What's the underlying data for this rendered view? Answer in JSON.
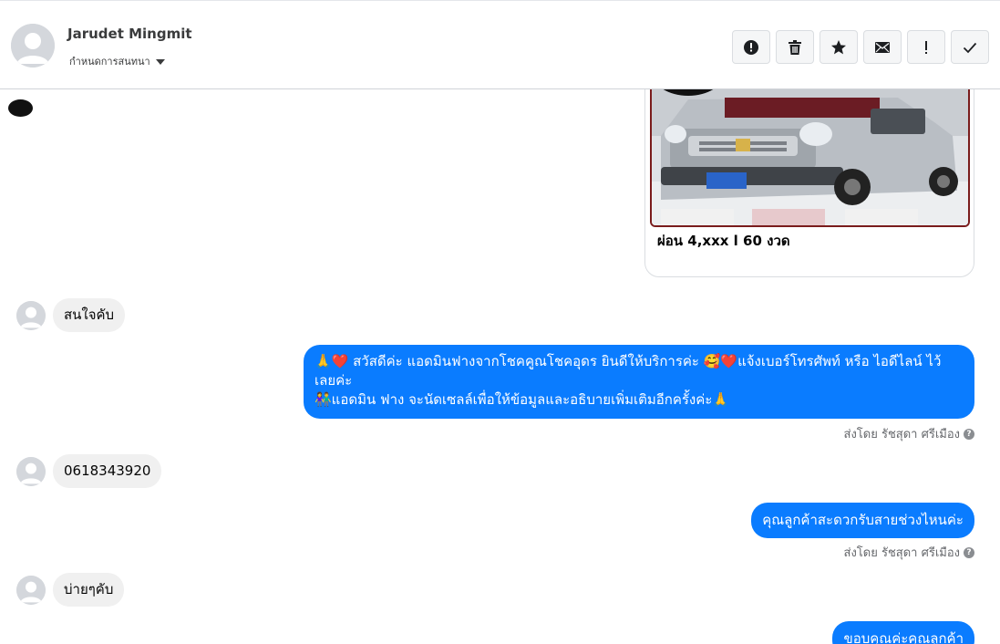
{
  "header": {
    "contact_name": "Jarudet Mingmit",
    "conversation_setting": "กำหนดการสนทนา",
    "toolbar": [
      {
        "icon": "alert-circle-icon",
        "name": "spam-button"
      },
      {
        "icon": "trash-icon",
        "name": "delete-button"
      },
      {
        "icon": "star-icon",
        "name": "star-button"
      },
      {
        "icon": "envelope-icon",
        "name": "mark-unread-button"
      },
      {
        "icon": "exclamation-icon",
        "name": "flag-button"
      },
      {
        "icon": "check-icon",
        "name": "done-button"
      }
    ]
  },
  "thread": {
    "card": {
      "title": "ผ่อน 4,xxx l 60 งวด"
    },
    "messages": [
      {
        "direction": "in",
        "text": "สนใจคับ"
      },
      {
        "direction": "out",
        "lines": [
          "🙏❤️ สวัสดีค่ะ แอดมินฟางจากโชคคูณโชคอุดร ยินดีให้บริการค่ะ 🥰❤️แจ้งเบอร์โทรศัพท์ หรือ ไอดีไลน์  ไว้",
          "เลยค่ะ",
          "👫แอดมิน ฟาง จะนัดเซลล์เพื่อให้ข้อมูลและอธิบายเพิ่มเติมอีกครั้งค่ะ🙏"
        ],
        "sent_by": "ส่งโดย รัชสุดา ศรีเมือง"
      },
      {
        "direction": "in",
        "text": "0618343920"
      },
      {
        "direction": "out",
        "text": "คุณลูกค้าสะดวกรับสายช่วงไหนค่ะ",
        "sent_by": "ส่งโดย รัชสุดา ศรีเมือง"
      },
      {
        "direction": "in",
        "text": "บ่ายๆคับ"
      },
      {
        "direction": "out",
        "text": "ขอบคุณค่ะคุณลูกค้า"
      }
    ]
  },
  "colors": {
    "outgoing_bubble": "#0a7cff",
    "incoming_bubble": "#f0f0f0",
    "meta_text": "#65676b"
  }
}
